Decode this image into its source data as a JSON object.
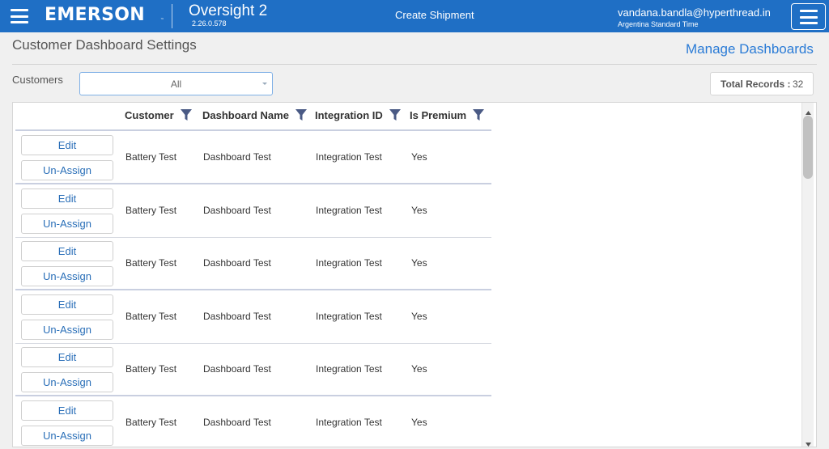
{
  "header": {
    "logo_text": "EMERSON",
    "logo_tm": "™",
    "app_name": "Oversight 2",
    "version": "2.26.0.578",
    "center_link": "Create Shipment",
    "user_email": "vandana.bandla@hyperthread.in",
    "timezone": "Argentina Standard Time",
    "bar_color": "#1f6fc5"
  },
  "page": {
    "title": "Customer Dashboard Settings",
    "manage_link": "Manage Dashboards"
  },
  "filters": {
    "customers_label": "Customers",
    "customers_value": "All",
    "total_label": "Total Records :",
    "total_value": "32"
  },
  "grid": {
    "columns": [
      {
        "label": "Customer"
      },
      {
        "label": "Dashboard Name"
      },
      {
        "label": "Integration ID"
      },
      {
        "label": "Is Premium"
      }
    ],
    "edit_label": "Edit",
    "unassign_label": "Un-Assign",
    "rows": [
      {
        "customer": "Battery Test",
        "dashboard": "Dashboard Test",
        "integration": "Integration Test",
        "premium": "Yes"
      },
      {
        "customer": "Battery Test",
        "dashboard": "Dashboard Test",
        "integration": "Integration Test",
        "premium": "Yes"
      },
      {
        "customer": "Battery Test",
        "dashboard": "Dashboard Test",
        "integration": "Integration Test",
        "premium": "Yes"
      },
      {
        "customer": "Battery Test",
        "dashboard": "Dashboard Test",
        "integration": "Integration Test",
        "premium": "Yes"
      },
      {
        "customer": "Battery Test",
        "dashboard": "Dashboard Test",
        "integration": "Integration Test",
        "premium": "Yes"
      },
      {
        "customer": "Battery Test",
        "dashboard": "Dashboard Test",
        "integration": "Integration Test",
        "premium": "Yes"
      }
    ]
  },
  "icons": {
    "menu": "menu-icon",
    "filter": "filter-icon",
    "dropdown": "chevron-down-icon",
    "scroll_up": "arrow-up-icon",
    "scroll_down": "arrow-down-icon"
  }
}
